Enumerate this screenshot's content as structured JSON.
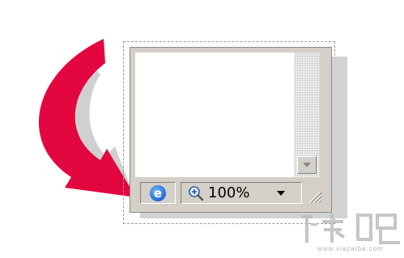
{
  "statusbar": {
    "zone_icon": "ie-logo-icon",
    "zoom_icon": "magnifier-zoom-icon",
    "zoom_level": "100%",
    "zoom_menu_icon": "chevron-down-icon",
    "resize_icon": "size-grip-icon"
  },
  "scrollbar": {
    "down_icon": "scroll-down-arrow-icon"
  },
  "annotation": {
    "arrow_color": "#e3063f",
    "arrow_shadow_color": "#c8c8c8"
  },
  "watermark": {
    "logo_text": "下载吧",
    "url": "www.xiazaiba.com"
  }
}
